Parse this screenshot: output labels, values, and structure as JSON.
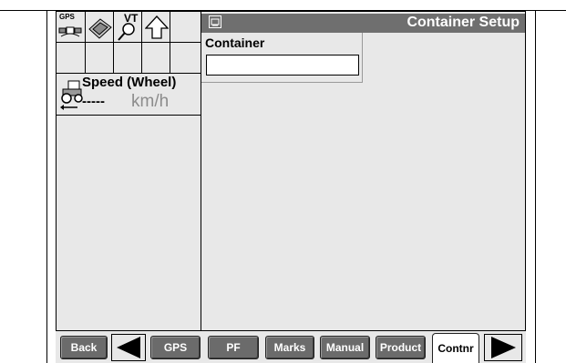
{
  "status_icons": {
    "gps_label": "GPS",
    "vt_label": "VT"
  },
  "speed": {
    "label": "Speed (Wheel)",
    "value": "-----",
    "unit": "km/h"
  },
  "header": {
    "title": "Container Setup"
  },
  "container": {
    "label": "Container",
    "value": ""
  },
  "softkeys": {
    "back": "Back",
    "gps": "GPS",
    "pf": "PF",
    "marks": "Marks",
    "manual": "Manual",
    "product": "Product",
    "contnr": "Contnr"
  },
  "colors": {
    "titlebar": "#6f6f6f",
    "softkey": "#6b6b6b",
    "background": "#e8e8e8"
  }
}
